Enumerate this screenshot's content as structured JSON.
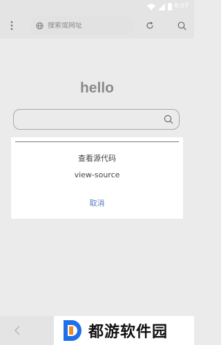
{
  "status_bar": {
    "time": "6:07",
    "icons": [
      "wifi-icon",
      "signal-icon",
      "battery-icon"
    ]
  },
  "toolbar": {
    "menu_icon": "more-vertical-icon",
    "address_placeholder": "搜索或网址",
    "address_icon": "globe-icon",
    "reload_icon": "reload-icon",
    "search_icon": "search-icon"
  },
  "home": {
    "logo_text": "hello",
    "search_value": ""
  },
  "dialog": {
    "items": [
      "查看源代码",
      "view-source"
    ],
    "cancel_label": "取消"
  },
  "bottom_bar": {
    "back_icon": "back-arrow-icon"
  },
  "watermark": {
    "text": "都游软件园"
  },
  "colors": {
    "background": "#ebebeb",
    "dialog": "#ffffff",
    "cancel_text": "#5a7fc2",
    "logo_text": "#8a8a8a",
    "watermark_blue": "#1e6fe8",
    "watermark_orange": "#f08a24"
  }
}
